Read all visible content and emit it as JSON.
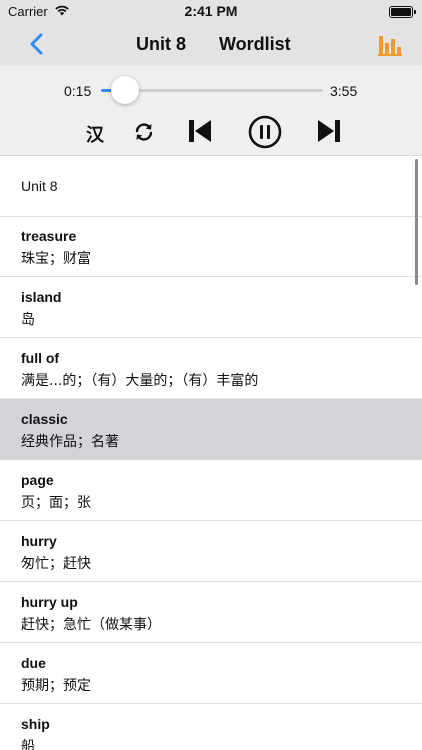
{
  "status_bar": {
    "carrier": "Carrier",
    "time": "2:41 PM"
  },
  "nav": {
    "unit_title": "Unit 8",
    "section_title": "Wordlist",
    "accent_color": "#f29a2e",
    "back_color": "#2d8cf0"
  },
  "player": {
    "current_time": "0:15",
    "total_time": "3:55",
    "progress": 0.11,
    "translate_label": "汉",
    "controls": [
      "translate",
      "repeat-icon",
      "previous-icon",
      "pause-icon",
      "next-icon"
    ]
  },
  "list": {
    "header": "Unit 8",
    "items": [
      {
        "word": "treasure",
        "meaning": "珠宝；财富"
      },
      {
        "word": "island",
        "meaning": "岛"
      },
      {
        "word": "full of",
        "meaning": "满是...的；（有）大量的；（有）丰富的"
      },
      {
        "word": "classic",
        "meaning": "经典作品；名著",
        "selected": true
      },
      {
        "word": "page",
        "meaning": "页；面；张"
      },
      {
        "word": "hurry",
        "meaning": "匆忙；赶快"
      },
      {
        "word": "hurry up",
        "meaning": "赶快；急忙（做某事）"
      },
      {
        "word": "due",
        "meaning": "预期；预定"
      },
      {
        "word": "ship",
        "meaning": "船"
      }
    ]
  }
}
